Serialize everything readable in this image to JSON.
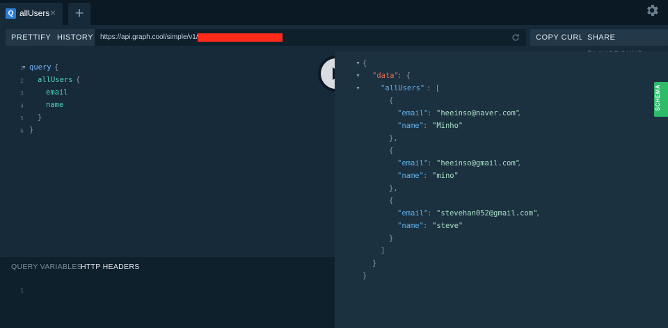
{
  "tabs": [
    {
      "badge": "Q",
      "label": "allUsers"
    }
  ],
  "toolbar": {
    "prettify": "PRETTIFY",
    "history": "HISTORY",
    "url": "https://api.graph.cool/simple/v1/cj",
    "copy_curl": "COPY CURL",
    "share": "SHARE PLAYGROUND"
  },
  "editor": {
    "line_numbers": [
      "1",
      "2",
      "3",
      "4",
      "5",
      "6"
    ],
    "query_kw": "query",
    "brace_open": "{",
    "field_allusers": "allUsers",
    "field_email": "email",
    "field_name": "name",
    "brace_close": "}"
  },
  "variables": {
    "tab_query_variables": "QUERY VARIABLES",
    "tab_http_headers": "HTTP HEADERS",
    "line_number": "1"
  },
  "result": {
    "key_data": "\"data\"",
    "key_allusers": "\"allUsers\"",
    "key_email": "\"email\"",
    "key_name": "\"name\"",
    "users": [
      {
        "email": "\"heeinso@naver.com\"",
        "name": "\"Minho\""
      },
      {
        "email": "\"heeinso@gmail.com\"",
        "name": "\"mino\""
      },
      {
        "email": "\"stevehan052@gmail.com\"",
        "name": "\"steve\""
      }
    ]
  },
  "schema_label": "SCHEMA",
  "colors": {
    "accent": "#2ebc6b",
    "tab_badge": "#2a7ed2",
    "redact": "#ff2a1a"
  },
  "icons": [
    "gear-icon",
    "plus-icon",
    "close-icon",
    "reload-icon",
    "play-icon",
    "fold-arrow-icon"
  ]
}
